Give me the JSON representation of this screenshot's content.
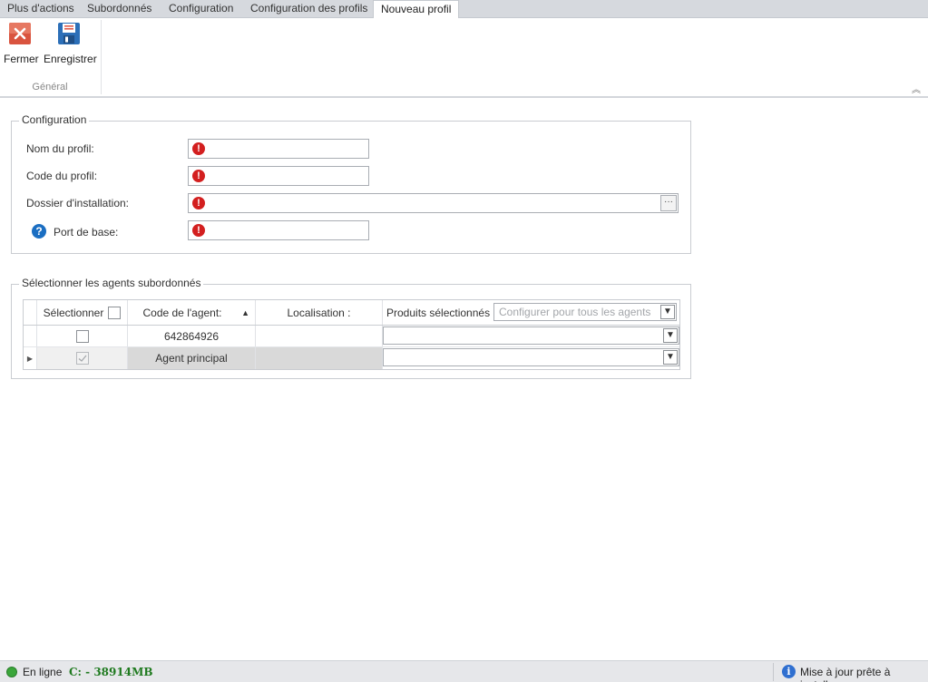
{
  "tabs": [
    {
      "label": "Plus d'actions"
    },
    {
      "label": "Subordonnés"
    },
    {
      "label": "Configuration"
    },
    {
      "label": "Configuration des profils"
    },
    {
      "label": "Nouveau profil",
      "active": true
    }
  ],
  "ribbon": {
    "close_label": "Fermer",
    "save_label": "Enregistrer",
    "group_label": "Général"
  },
  "configuration": {
    "legend": "Configuration",
    "fields": {
      "profile_name_label": "Nom du profil:",
      "profile_code_label": "Code du profil:",
      "install_folder_label": "Dossier d'installation:",
      "base_port_label": "Port de base:"
    },
    "values": {
      "profile_name": "",
      "profile_code": "",
      "install_folder": "",
      "base_port": ""
    },
    "error_glyph": "!",
    "browse_label": "···"
  },
  "agents": {
    "legend": "Sélectionner les agents subordonnés",
    "columns": {
      "select": "Sélectionner",
      "code": "Code de l'agent:",
      "location": "Localisation :",
      "products": "Produits sélectionnés"
    },
    "configure_all_placeholder": "Configurer pour tous les agents",
    "rows": [
      {
        "code": "642864926",
        "location": "",
        "selected": false,
        "enabled": true
      },
      {
        "code": "Agent principal",
        "location": "",
        "selected": true,
        "enabled": false
      }
    ]
  },
  "statusbar": {
    "online_label": "En ligne",
    "disk_label": "C: - 38914MB",
    "update_label": "Mise à jour prête à installer"
  },
  "colors": {
    "accent_blue": "#1b6ec2",
    "error_red": "#d31f1f",
    "online_green": "#3aa63a",
    "disk_text_green": "#1f7a1f"
  }
}
